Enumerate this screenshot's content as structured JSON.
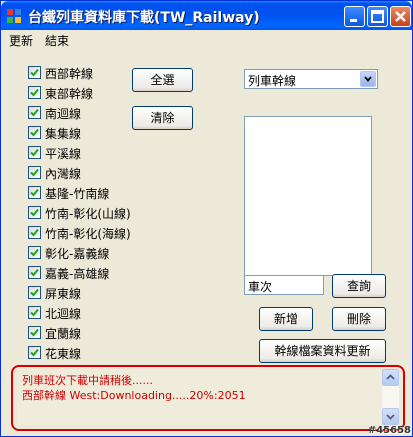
{
  "window": {
    "title": "台鐵列車資料庫下載(TW_Railway)"
  },
  "menu": [
    "更新",
    "結束"
  ],
  "lines": [
    {
      "label": "西部幹線",
      "checked": true
    },
    {
      "label": "東部幹線",
      "checked": true
    },
    {
      "label": "南迴線",
      "checked": true
    },
    {
      "label": "集集線",
      "checked": true
    },
    {
      "label": "平溪線",
      "checked": true
    },
    {
      "label": "內灣線",
      "checked": true
    },
    {
      "label": "基隆-竹南線",
      "checked": true
    },
    {
      "label": "竹南-彰化(山線)",
      "checked": true
    },
    {
      "label": "竹南-彰化(海線)",
      "checked": true
    },
    {
      "label": "彰化-嘉義線",
      "checked": true
    },
    {
      "label": "嘉義-高雄線",
      "checked": true
    },
    {
      "label": "屏東線",
      "checked": true
    },
    {
      "label": "北迴線",
      "checked": true
    },
    {
      "label": "宜蘭線",
      "checked": true
    },
    {
      "label": "花東線",
      "checked": true
    }
  ],
  "buttons": {
    "select_all": "全選",
    "clear": "清除",
    "query": "查詢",
    "add": "新增",
    "delete": "刪除",
    "update_files": "幹線檔案資料更新"
  },
  "line_select": {
    "value": "列車幹線"
  },
  "train_no": {
    "value": "車次"
  },
  "log": {
    "lines": [
      "列車班次下載中請稍後......",
      "西部幹線 West:Downloading.....20%:2051"
    ]
  },
  "watermark": "#45658",
  "colors": {
    "log_text": "#cc0000",
    "log_border": "#d40000",
    "title_bar": "#0054e3"
  }
}
